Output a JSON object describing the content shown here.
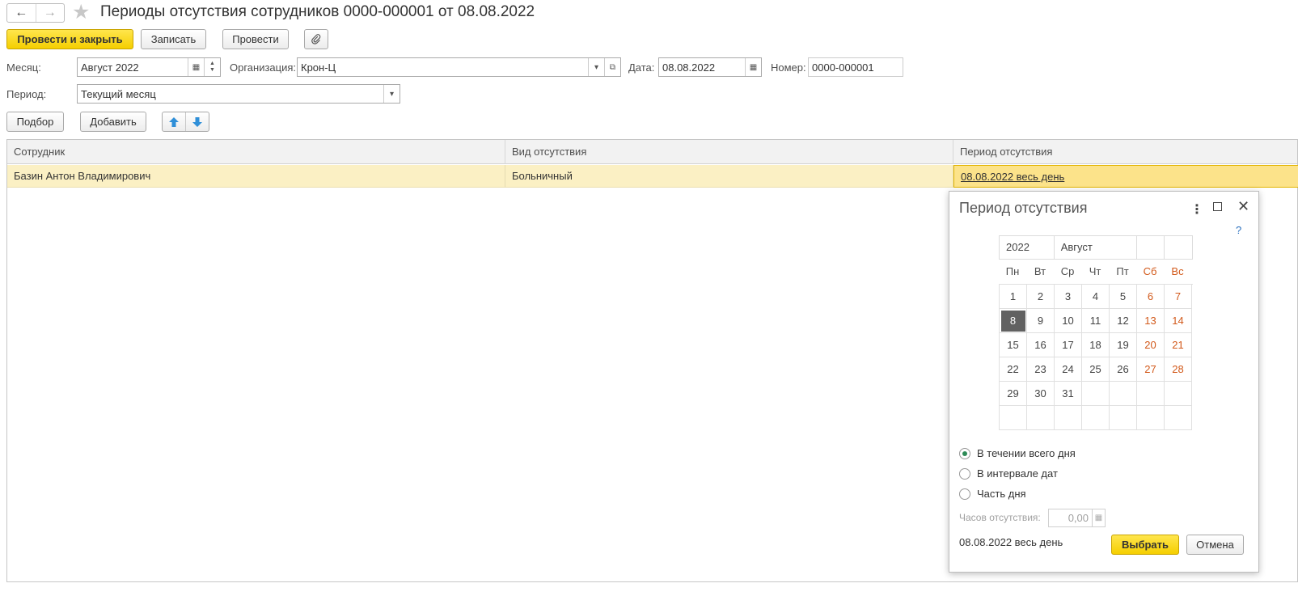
{
  "window": {
    "title": "Периоды отсутствия сотрудников 0000-000001 от 08.08.2022"
  },
  "toolbar": {
    "post_close": "Провести и закрыть",
    "save": "Записать",
    "post": "Провести"
  },
  "form": {
    "month_label": "Месяц:",
    "month_value": "Август 2022",
    "org_label": "Организация:",
    "org_value": "Крон-Ц",
    "date_label": "Дата:",
    "date_value": "08.08.2022",
    "number_label": "Номер:",
    "number_value": "0000-000001",
    "period_label": "Период:",
    "period_value": "Текущий месяц"
  },
  "table_toolbar": {
    "pick": "Подбор",
    "add": "Добавить"
  },
  "table": {
    "columns": [
      "Сотрудник",
      "Вид отсутствия",
      "Период отсутствия"
    ],
    "rows": [
      {
        "employee": "Базин Антон Владимирович",
        "type": "Больничный",
        "period": "08.08.2022 весь день"
      }
    ]
  },
  "popup": {
    "title": "Период отсутствия",
    "help": "?",
    "year": "2022",
    "month": "Август",
    "weekdays": [
      "Пн",
      "Вт",
      "Ср",
      "Чт",
      "Пт",
      "Сб",
      "Вс"
    ],
    "days": [
      "1",
      "2",
      "3",
      "4",
      "5",
      "6",
      "7",
      "8",
      "9",
      "10",
      "11",
      "12",
      "13",
      "14",
      "15",
      "16",
      "17",
      "18",
      "19",
      "20",
      "21",
      "22",
      "23",
      "24",
      "25",
      "26",
      "27",
      "28",
      "29",
      "30",
      "31"
    ],
    "first_weekday_offset": 0,
    "selected_day": "8",
    "options": [
      "В течении всего дня",
      "В интервале дат",
      "Часть дня"
    ],
    "selected_option": 0,
    "hours_label": "Часов отсутствия:",
    "hours_value": "0,00",
    "summary": "08.08.2022 весь день",
    "ok": "Выбрать",
    "cancel": "Отмена"
  },
  "colors": {
    "accent_yellow": "#f5cf00",
    "weekend": "#d2591a",
    "selected_row": "#fbf0c4"
  }
}
